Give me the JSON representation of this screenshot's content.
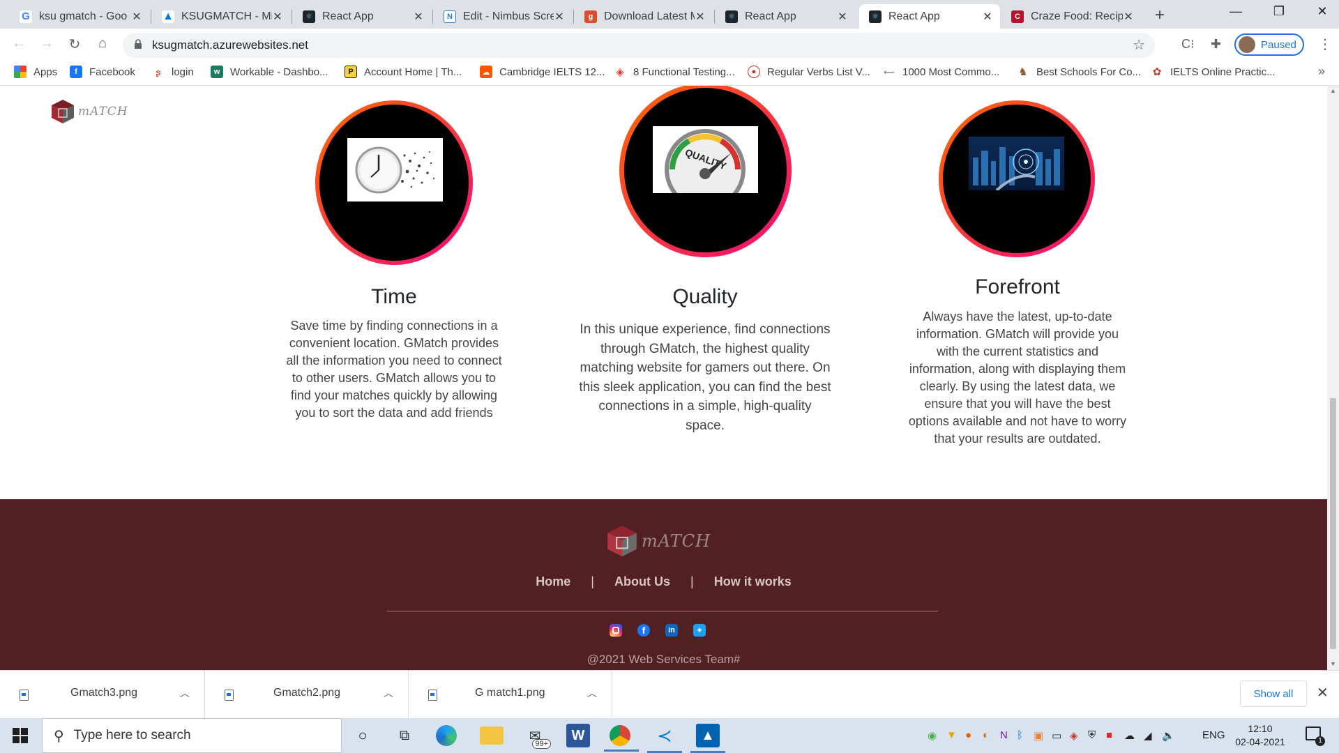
{
  "tabs": [
    {
      "title": "ksu gmatch - Goo",
      "icon": "google-icon",
      "color": "#4285f4"
    },
    {
      "title": "KSUGMATCH - Mic",
      "icon": "azure-icon",
      "color": "#0078d4"
    },
    {
      "title": "React App",
      "icon": "react-icon",
      "color": "#20232a"
    },
    {
      "title": "Edit - Nimbus Scre",
      "icon": "nimbus-icon",
      "color": "#2d7db3"
    },
    {
      "title": "Download Latest M",
      "icon": "g-red-icon",
      "color": "#e04b2d"
    },
    {
      "title": "React App",
      "icon": "react-icon",
      "color": "#20232a"
    },
    {
      "title": "React App",
      "icon": "react-icon",
      "color": "#20232a"
    },
    {
      "title": "Craze Food: Recipe",
      "icon": "craze-food-icon",
      "color": "#b3152a"
    }
  ],
  "address_bar": {
    "url": "ksugmatch.azurewebsites.net"
  },
  "profile": {
    "status": "Paused"
  },
  "bookmarks": [
    {
      "label": "Apps",
      "icon": "apps-grid-icon",
      "color": "#e94335"
    },
    {
      "label": "Facebook",
      "icon": "facebook-icon",
      "color": "#1877f2"
    },
    {
      "label": "login",
      "icon": "login-icon",
      "color": "#e0533c"
    },
    {
      "label": "Workable - Dashbo...",
      "icon": "workable-icon",
      "color": "#1d7a5f"
    },
    {
      "label": "Account Home | Th...",
      "icon": "account-home-icon",
      "color": "#222222"
    },
    {
      "label": "Cambridge IELTS 12...",
      "icon": "soundcloud-icon",
      "color": "#ff5500"
    },
    {
      "label": "8 Functional Testing...",
      "icon": "testing-icon",
      "color": "#e5383b"
    },
    {
      "label": "Regular Verbs List V...",
      "icon": "verbs-icon",
      "color": "#c0392b"
    },
    {
      "label": "1000 Most Commo...",
      "icon": "dash-icon",
      "color": "#777777"
    },
    {
      "label": "Best Schools For Co...",
      "icon": "owl-icon",
      "color": "#8b5a2b"
    },
    {
      "label": "IELTS Online Practic...",
      "icon": "ielts-icon",
      "color": "#c0392b"
    }
  ],
  "site": {
    "logo_text": "mATCH",
    "features": [
      {
        "title": "Time",
        "image": "clock-image",
        "text": "Save time by finding connections in a convenient location. GMatch provides all the information you need to connect to other users. GMatch allows you to find your matches quickly by allowing you to sort the data and add friends"
      },
      {
        "title": "Quality",
        "image": "quality-gauge-image",
        "text": "In this unique experience, find connections through GMatch, the highest quality matching website for gamers out there. On this sleek application, you can find the best connections in a simple, high-quality space."
      },
      {
        "title": "Forefront",
        "image": "city-tech-image",
        "text": "Always have the latest, up-to-date information. GMatch will provide you with the current statistics and information, along with displaying them clearly. By using the latest data, we ensure that you will have the best options available and not have to worry that your results are outdated."
      }
    ],
    "footer": {
      "logo_text": "mATCH",
      "links": [
        "Home",
        "About Us",
        "How it works"
      ],
      "separator": "|",
      "socials": [
        {
          "icon": "instagram-icon",
          "color": "#d6249f"
        },
        {
          "icon": "facebook-icon",
          "color": "#1877f2"
        },
        {
          "icon": "linkedin-icon",
          "color": "#0a66c2"
        },
        {
          "icon": "twitter-icon",
          "color": "#1da1f2"
        }
      ],
      "copyright": "@2021 Web Services Team#"
    },
    "colors": {
      "footer_bg": "#521f22",
      "ring_start": "#ff6a00",
      "ring_end": "#ee0979"
    }
  },
  "downloads": {
    "items": [
      {
        "name": "Gmatch3.png"
      },
      {
        "name": "Gmatch2.png"
      },
      {
        "name": "G match1.png"
      }
    ],
    "show_all": "Show all"
  },
  "taskbar": {
    "search_placeholder": "Type here to search",
    "mail_badge": "99+",
    "language": "ENG",
    "time": "12:10",
    "date": "02-04-2021",
    "notification_count": "1"
  }
}
